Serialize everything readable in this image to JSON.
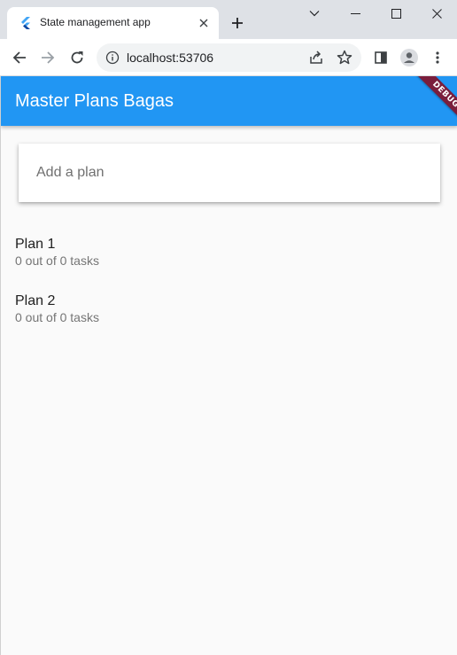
{
  "browser": {
    "tab": {
      "title": "State management app",
      "favicon": "flutter-icon",
      "close_icon": "close-icon"
    },
    "new_tab_icon": "plus-icon",
    "window_controls": [
      "tab-search-icon",
      "minimize-icon",
      "maximize-icon",
      "close-icon"
    ],
    "address": {
      "url": "localhost:53706",
      "info_icon": "info-icon",
      "share_icon": "share-icon",
      "bookmark_icon": "star-icon"
    },
    "nav_icons": [
      "back-arrow-icon",
      "forward-arrow-icon",
      "reload-icon"
    ],
    "right_icons": [
      "side-panel-icon",
      "profile-icon",
      "more-vert-icon"
    ]
  },
  "app": {
    "title": "Master Plans Bagas",
    "debug_banner": "DEBUG",
    "add_plan": {
      "placeholder": "Add a plan",
      "value": ""
    },
    "plans": [
      {
        "title": "Plan 1",
        "subtitle": "0 out of 0 tasks"
      },
      {
        "title": "Plan 2",
        "subtitle": "0 out of 0 tasks"
      }
    ]
  },
  "colors": {
    "appbar": "#2196f3",
    "debug_banner": "#7a1e3c",
    "background": "#fafafa",
    "tabstrip": "#dee1e6"
  }
}
